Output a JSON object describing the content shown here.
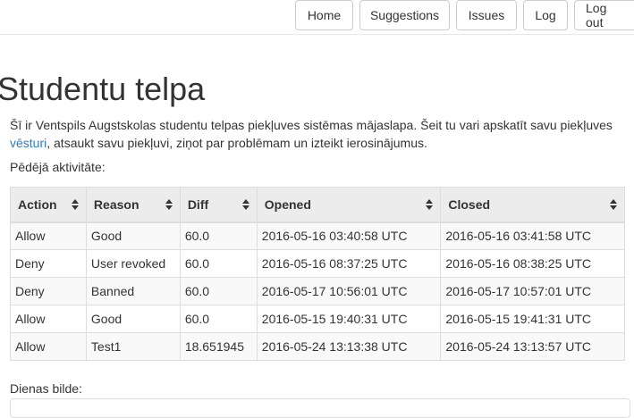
{
  "nav": {
    "items": [
      "Home",
      "Suggestions",
      "Issues",
      "Log",
      "Log out"
    ]
  },
  "page": {
    "title": "Studentu telpa",
    "intro_before_link": "Šī ir Ventspils Augstskolas studentu telpas piekļuves sistēmas mājaslapa. Šeit tu vari apskatīt savu piekļuves ",
    "intro_link": "vēsturi",
    "intro_after_link": ", atsaukt savu piekļuvi, ziņot par problēmam un izteikt ierosinājumus.",
    "activity_label": "Pēdējā aktivitāte:",
    "photo_label": "Dienas bilde:"
  },
  "table": {
    "headers": [
      "Action",
      "Reason",
      "Diff",
      "Opened",
      "Closed"
    ],
    "rows": [
      [
        "Allow",
        "Good",
        "60.0",
        "2016-05-16 03:40:58 UTC",
        "2016-05-16 03:41:58 UTC"
      ],
      [
        "Deny",
        "User revoked",
        "60.0",
        "2016-05-16 08:37:25 UTC",
        "2016-05-16 08:38:25 UTC"
      ],
      [
        "Deny",
        "Banned",
        "60.0",
        "2016-05-17 10:56:01 UTC",
        "2016-05-17 10:57:01 UTC"
      ],
      [
        "Allow",
        "Good",
        "60.0",
        "2016-05-15 19:40:31 UTC",
        "2016-05-15 19:41:31 UTC"
      ],
      [
        "Allow",
        "Test1",
        "18.651945",
        "2016-05-24 13:13:38 UTC",
        "2016-05-24 13:13:57 UTC"
      ]
    ]
  },
  "colors": {
    "link": "#337ab7",
    "header_bg": "#ececec",
    "stripe": "#f9f9f9",
    "border": "#dddddd"
  }
}
